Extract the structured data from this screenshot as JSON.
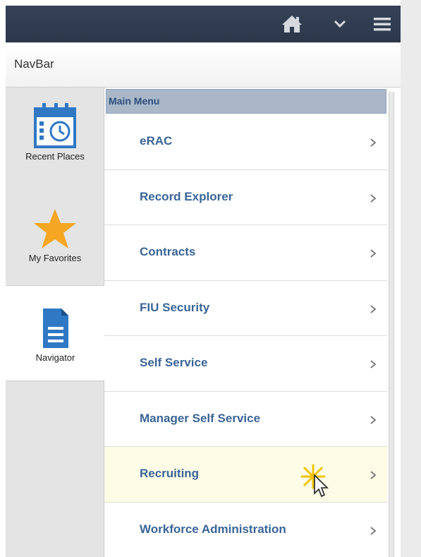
{
  "header": {
    "home_icon": "home-icon",
    "dropdown_icon": "chevron-down-icon",
    "menu_icon": "hamburger-menu-icon"
  },
  "navbar": {
    "title": "NavBar"
  },
  "tabs": {
    "recent_places": "Recent Places",
    "my_favorites": "My Favorites",
    "navigator": "Navigator"
  },
  "menu": {
    "title": "Main Menu",
    "items": [
      {
        "label": "eRAC"
      },
      {
        "label": "Record Explorer"
      },
      {
        "label": "Contracts"
      },
      {
        "label": "FIU Security"
      },
      {
        "label": "Self Service"
      },
      {
        "label": "Manager Self Service"
      },
      {
        "label": "Recruiting"
      },
      {
        "label": "Workforce Administration"
      }
    ]
  },
  "colors": {
    "banner": "#2f3b4e",
    "menu_header": "#a9b7c8",
    "menu_link": "#3a6596",
    "highlight_row": "#fdfce7",
    "favorite_star": "#f5a623",
    "document_blue": "#2f78c4"
  }
}
